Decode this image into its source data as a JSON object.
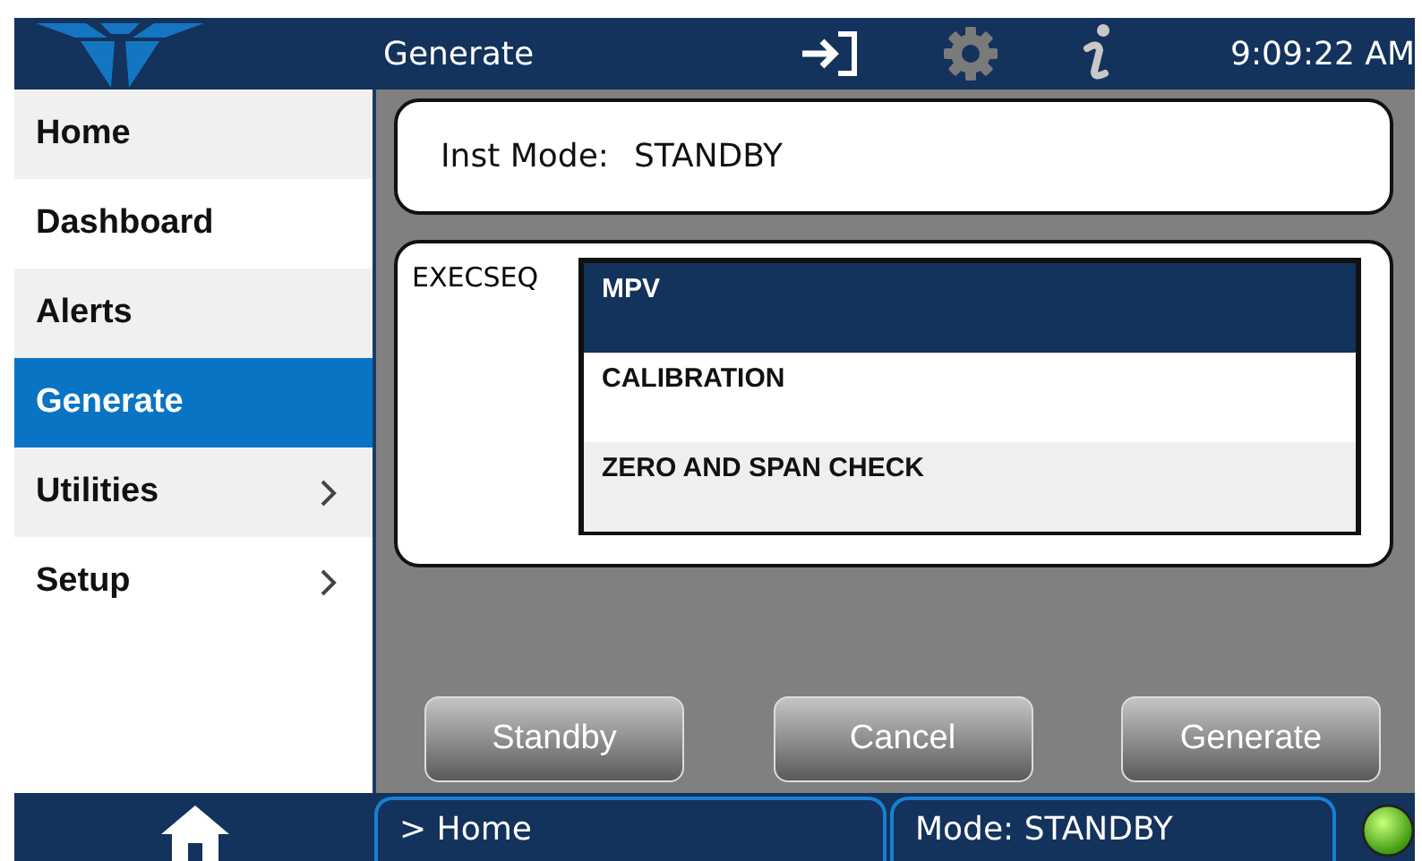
{
  "header": {
    "title": "Generate",
    "time": "9:09:22 AM"
  },
  "sidebar": {
    "items": [
      {
        "label": "Home",
        "selected": false,
        "has_submenu": false
      },
      {
        "label": "Dashboard",
        "selected": false,
        "has_submenu": false
      },
      {
        "label": "Alerts",
        "selected": false,
        "has_submenu": false
      },
      {
        "label": "Generate",
        "selected": true,
        "has_submenu": false
      },
      {
        "label": "Utilities",
        "selected": false,
        "has_submenu": true
      },
      {
        "label": "Setup",
        "selected": false,
        "has_submenu": true
      }
    ]
  },
  "inst_mode": {
    "label": "Inst Mode:",
    "value": "STANDBY"
  },
  "sequence": {
    "label": "EXECSEQ",
    "items": [
      {
        "label": "MPV",
        "selected": true
      },
      {
        "label": "CALIBRATION",
        "selected": false
      },
      {
        "label": "ZERO AND SPAN CHECK",
        "selected": false
      }
    ]
  },
  "buttons": [
    "Standby",
    "Cancel",
    "Generate"
  ],
  "status_bar": {
    "breadcrumb": "> Home",
    "mode": "Mode: STANDBY"
  }
}
